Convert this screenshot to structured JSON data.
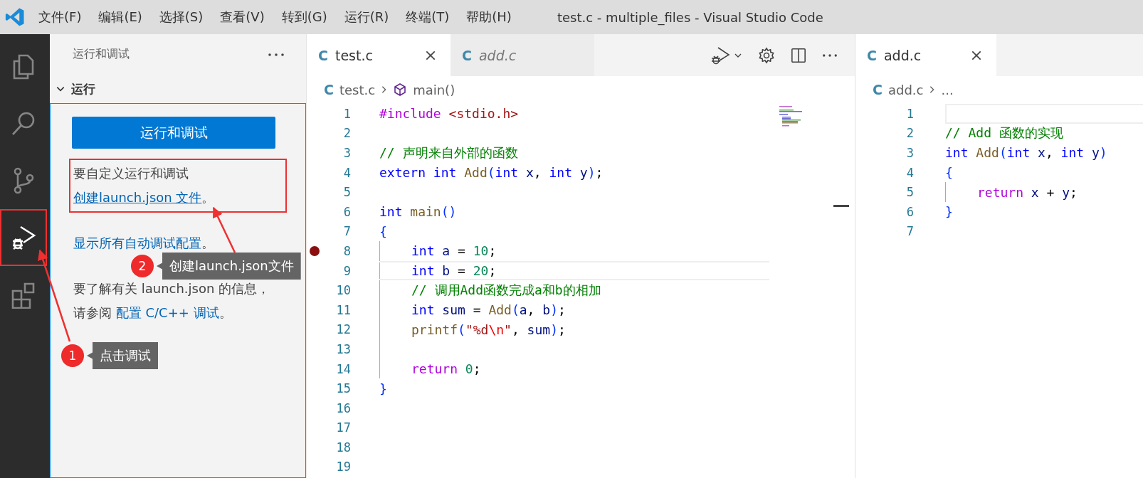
{
  "title_bar": {
    "menu": [
      "文件(F)",
      "编辑(E)",
      "选择(S)",
      "查看(V)",
      "转到(G)",
      "运行(R)",
      "终端(T)",
      "帮助(H)"
    ],
    "title": "test.c - multiple_files - Visual Studio Code"
  },
  "activity_bar": [
    {
      "kind": "files",
      "selected": false,
      "annotated": false
    },
    {
      "kind": "search",
      "selected": false,
      "annotated": false
    },
    {
      "kind": "branches",
      "selected": false,
      "annotated": false
    },
    {
      "kind": "debug",
      "selected": true,
      "annotated": true
    },
    {
      "kind": "extensions",
      "selected": false,
      "annotated": false
    }
  ],
  "sidebar": {
    "title": "运行和调试",
    "section": {
      "label": "运行",
      "expanded": true
    },
    "button": "运行和调试",
    "paragraphs": [
      {
        "annotated": true,
        "parts": [
          {
            "text": "要自定义运行和调试"
          },
          {
            "text": "创建launch.json 文件",
            "link": true,
            "focused": true
          },
          {
            "text": "。"
          }
        ]
      },
      {
        "annotated": false,
        "parts": [
          {
            "text": "显示所有自动调试配置",
            "link": true,
            "focused": false
          },
          {
            "text": "。"
          }
        ]
      },
      {
        "annotated": false,
        "parts": [
          {
            "text": "要了解有关 launch.json 的信息，请参阅 "
          },
          {
            "text": "配置 C/C++ 调试",
            "link": true,
            "focused": false
          },
          {
            "text": "。"
          }
        ]
      }
    ]
  },
  "editor_groups": [
    {
      "tabs": [
        {
          "icon": "C",
          "label": "test.c",
          "selected": true,
          "preview": false
        },
        {
          "icon": "C",
          "label": "add.c",
          "selected": false,
          "preview": true
        }
      ],
      "toolbar": true,
      "breadcrumb": [
        {
          "kind": "file",
          "icon": "C",
          "text": "test.c"
        },
        {
          "kind": "function",
          "text": "main()"
        }
      ],
      "lines": [
        {
          "num": "1",
          "tokens": [
            {
              "kind": "pp",
              "t": "#include "
            },
            {
              "kind": "str",
              "t": "<stdio.h>"
            }
          ]
        },
        {
          "num": "2"
        },
        {
          "num": "3",
          "tokens": [
            {
              "kind": "cmt",
              "t": "// 声明来自外部的函数"
            }
          ]
        },
        {
          "num": "4",
          "tokens": [
            {
              "kind": "kw",
              "t": "extern "
            },
            {
              "kind": "kw",
              "t": "int "
            },
            {
              "kind": "fn",
              "t": "Add"
            },
            {
              "kind": "br",
              "t": "("
            },
            {
              "kind": "kw",
              "t": "int "
            },
            {
              "kind": "var",
              "t": "x"
            },
            {
              "kind": "p",
              "t": ", "
            },
            {
              "kind": "kw",
              "t": "int "
            },
            {
              "kind": "var",
              "t": "y"
            },
            {
              "kind": "br",
              "t": ")"
            },
            {
              "kind": "p",
              "t": ";"
            }
          ]
        },
        {
          "num": "5"
        },
        {
          "num": "6",
          "tokens": [
            {
              "kind": "kw",
              "t": "int "
            },
            {
              "kind": "fn",
              "t": "main"
            },
            {
              "kind": "br",
              "t": "()"
            }
          ]
        },
        {
          "num": "7",
          "tokens": [
            {
              "kind": "br",
              "t": "{"
            }
          ]
        },
        {
          "num": "8",
          "indented": true,
          "breakpoint": true,
          "tokens": [
            {
              "kind": "kw",
              "t": "int "
            },
            {
              "kind": "var",
              "t": "a"
            },
            {
              "kind": "p",
              "t": " = "
            },
            {
              "kind": "num",
              "t": "10"
            },
            {
              "kind": "p",
              "t": ";"
            }
          ]
        },
        {
          "num": "9",
          "indented": true,
          "highlighted": true,
          "tokens": [
            {
              "kind": "kw",
              "t": "int "
            },
            {
              "kind": "var",
              "t": "b"
            },
            {
              "kind": "p",
              "t": " = "
            },
            {
              "kind": "num",
              "t": "20"
            },
            {
              "kind": "p",
              "t": ";"
            }
          ]
        },
        {
          "num": "10",
          "indented": true,
          "tokens": [
            {
              "kind": "cmt",
              "t": "// 调用Add函数完成a和b的相加"
            }
          ]
        },
        {
          "num": "11",
          "indented": true,
          "tokens": [
            {
              "kind": "kw",
              "t": "int "
            },
            {
              "kind": "var",
              "t": "sum"
            },
            {
              "kind": "p",
              "t": " = "
            },
            {
              "kind": "fn",
              "t": "Add"
            },
            {
              "kind": "br",
              "t": "("
            },
            {
              "kind": "var",
              "t": "a"
            },
            {
              "kind": "p",
              "t": ", "
            },
            {
              "kind": "var",
              "t": "b"
            },
            {
              "kind": "br",
              "t": ")"
            },
            {
              "kind": "p",
              "t": ";"
            }
          ]
        },
        {
          "num": "12",
          "indented": true,
          "tokens": [
            {
              "kind": "fn",
              "t": "printf"
            },
            {
              "kind": "br",
              "t": "("
            },
            {
              "kind": "str",
              "t": "\"%d"
            },
            {
              "kind": "esc",
              "t": "\\n"
            },
            {
              "kind": "str",
              "t": "\""
            },
            {
              "kind": "p",
              "t": ", "
            },
            {
              "kind": "var",
              "t": "sum"
            },
            {
              "kind": "br",
              "t": ")"
            },
            {
              "kind": "p",
              "t": ";"
            }
          ]
        },
        {
          "num": "13",
          "indented": true
        },
        {
          "num": "14",
          "indented": true,
          "tokens": [
            {
              "kind": "ctl",
              "t": "return "
            },
            {
              "kind": "num",
              "t": "0"
            },
            {
              "kind": "p",
              "t": ";"
            }
          ]
        },
        {
          "num": "15",
          "tokens": [
            {
              "kind": "br",
              "t": "}"
            }
          ]
        },
        {
          "num": "16"
        },
        {
          "num": "17"
        },
        {
          "num": "18"
        },
        {
          "num": "19"
        }
      ]
    },
    {
      "tabs": [
        {
          "icon": "C",
          "label": "add.c",
          "selected": true,
          "preview": false
        }
      ],
      "toolbar": false,
      "breadcrumb": [
        {
          "kind": "file",
          "icon": "C",
          "text": "add.c"
        },
        {
          "kind": "more",
          "text": "..."
        }
      ],
      "lines": [
        {
          "num": "1",
          "highlighted": true
        },
        {
          "num": "2",
          "tokens": [
            {
              "kind": "cmt",
              "t": "// Add 函数的实现"
            }
          ]
        },
        {
          "num": "3",
          "tokens": [
            {
              "kind": "kw",
              "t": "int "
            },
            {
              "kind": "fn",
              "t": "Add"
            },
            {
              "kind": "br",
              "t": "("
            },
            {
              "kind": "kw",
              "t": "int "
            },
            {
              "kind": "var",
              "t": "x"
            },
            {
              "kind": "p",
              "t": ", "
            },
            {
              "kind": "kw",
              "t": "int "
            },
            {
              "kind": "var",
              "t": "y"
            },
            {
              "kind": "br",
              "t": ")"
            }
          ]
        },
        {
          "num": "4",
          "tokens": [
            {
              "kind": "br",
              "t": "{"
            }
          ]
        },
        {
          "num": "5",
          "indented": true,
          "tokens": [
            {
              "kind": "ctl",
              "t": "return "
            },
            {
              "kind": "var",
              "t": "x"
            },
            {
              "kind": "p",
              "t": " + "
            },
            {
              "kind": "var",
              "t": "y"
            },
            {
              "kind": "p",
              "t": ";"
            }
          ]
        },
        {
          "num": "6",
          "tokens": [
            {
              "kind": "br",
              "t": "}"
            }
          ]
        },
        {
          "num": "7"
        }
      ]
    }
  ],
  "callouts": [
    {
      "number": "1",
      "text": "点击调试"
    },
    {
      "number": "2",
      "text": "创建launch.json文件"
    }
  ]
}
